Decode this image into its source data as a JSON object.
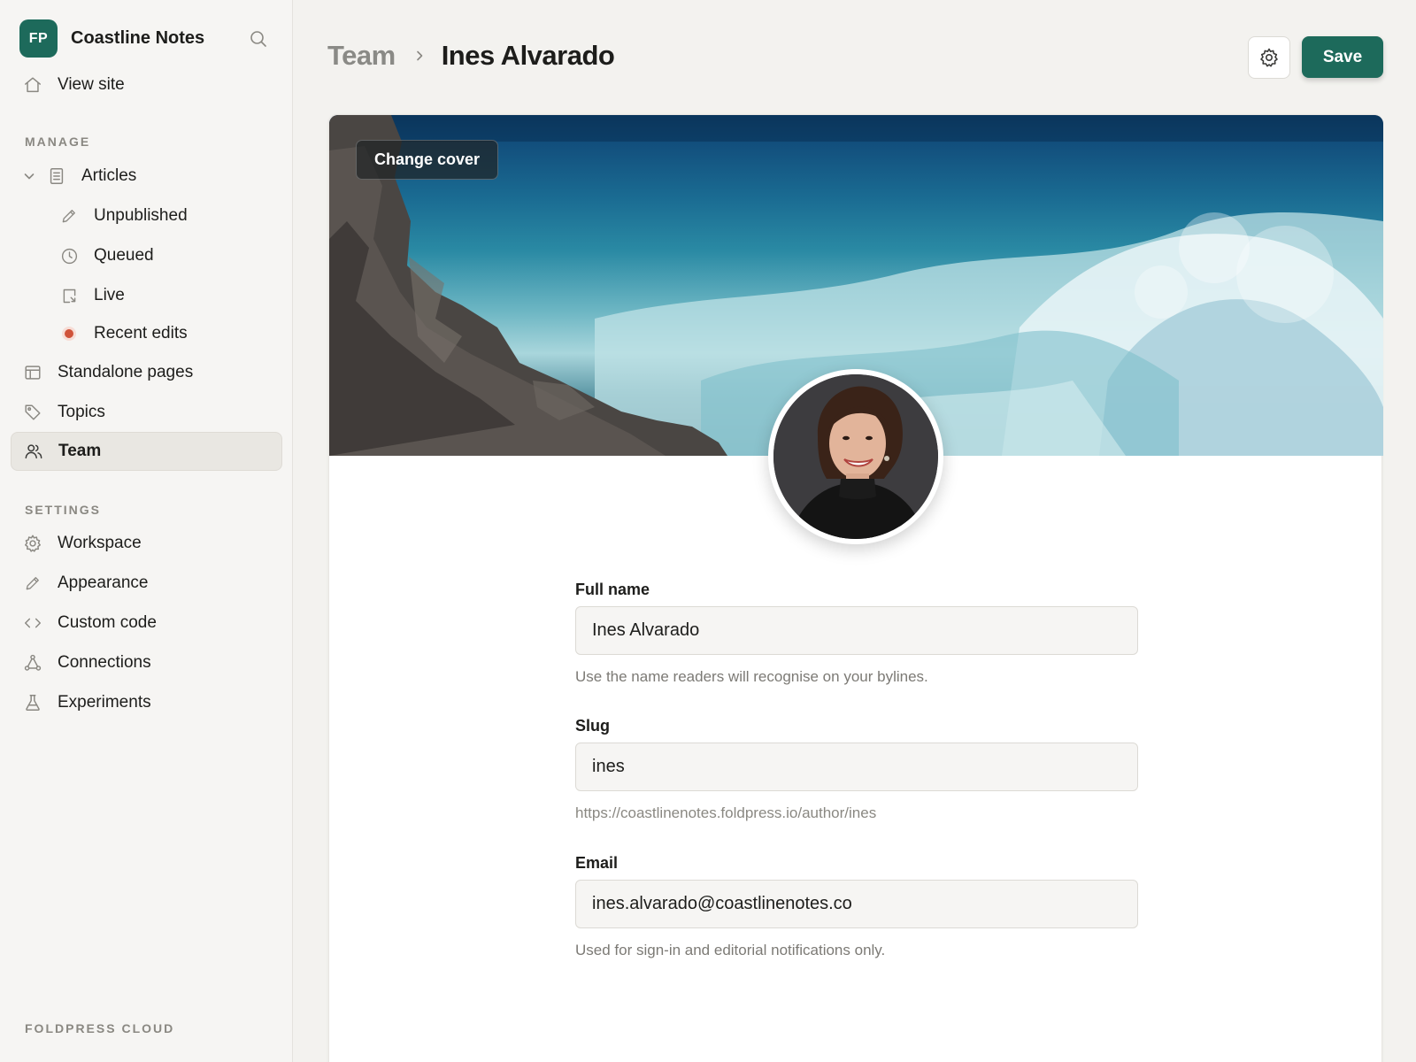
{
  "brand": {
    "initials": "FP",
    "name": "Coastline Notes",
    "logo_color": "#1d6a5b"
  },
  "sidebar": {
    "view_site": "View site",
    "manage_title": "MANAGE",
    "articles": "Articles",
    "article_subs": [
      {
        "label": "Unpublished",
        "icon": "pencil-icon"
      },
      {
        "label": "Queued",
        "icon": "clock-icon"
      },
      {
        "label": "Live",
        "icon": "published-icon"
      },
      {
        "label": "Recent edits",
        "icon": "red-dot-icon",
        "dot_color": "#d0533a"
      }
    ],
    "standalone_pages": "Standalone pages",
    "topics": "Topics",
    "team": "Team",
    "settings_title": "SETTINGS",
    "settings_items": [
      "Workspace",
      "Appearance",
      "Custom code",
      "Connections",
      "Experiments"
    ],
    "footer": "FOLDPRESS CLOUD"
  },
  "header": {
    "breadcrumb_parent": "Team",
    "breadcrumb_current": "Ines Alvarado",
    "save_label": "Save",
    "accent": "#1d6a5b"
  },
  "profile": {
    "change_cover": "Change cover",
    "full_name_label": "Full name",
    "full_name_value": "Ines Alvarado",
    "full_name_hint": "Use the name readers will recognise on your bylines.",
    "slug_label": "Slug",
    "slug_value": "ines",
    "slug_hint": "https://coastlinenotes.foldpress.io/author/ines",
    "email_label": "Email",
    "email_value": "ines.alvarado@coastlinenotes.co",
    "email_hint": "Used for sign-in and editorial notifications only."
  }
}
